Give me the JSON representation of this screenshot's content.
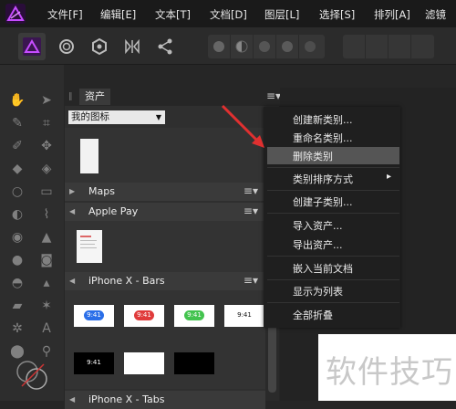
{
  "menubar": {
    "items": [
      "文件[F]",
      "编辑[E]",
      "文本[T]",
      "文档[D]",
      "图层[L]",
      "选择[S]",
      "排列[A]",
      "滤镜"
    ]
  },
  "colors": {
    "brand": "#b23cf0",
    "highlight": "#555555",
    "arrow": "#e03030"
  },
  "panel": {
    "tab_label": "资产",
    "category_select": "我的图标",
    "sections": [
      {
        "label": "Maps",
        "collapsed": true
      },
      {
        "label": "Apple Pay",
        "collapsed": false
      },
      {
        "label": "iPhone X - Bars",
        "collapsed": false
      },
      {
        "label": "iPhone X - Tabs",
        "collapsed": false
      }
    ],
    "bar_time": "9:41"
  },
  "context_menu": {
    "items": [
      "创建新类别...",
      "重命名类别...",
      "删除类别",
      "类别排序方式",
      "创建子类别...",
      "导入资产...",
      "导出资产...",
      "嵌入当前文档",
      "显示为列表",
      "全部折叠"
    ],
    "highlighted": "删除类别",
    "submenu_arrow": "▸"
  },
  "watermark": {
    "text": "软件技巧"
  }
}
